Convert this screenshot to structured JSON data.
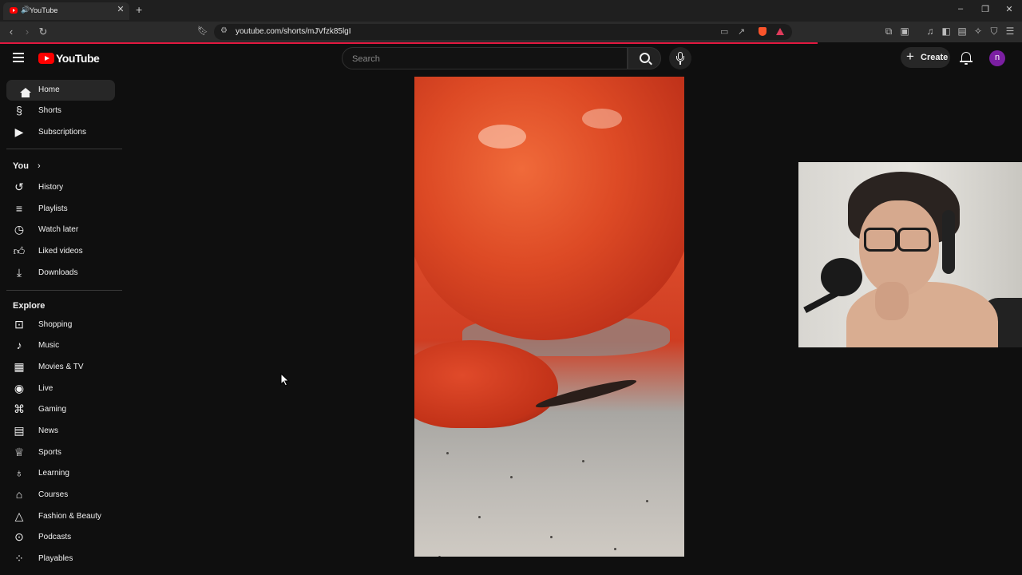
{
  "browser": {
    "tab": {
      "title": "YouTube"
    },
    "url": "youtube.com/shorts/mJVfzk85lgI"
  },
  "masthead": {
    "logo_text": "YouTube",
    "search_placeholder": "Search",
    "create_label": "Create",
    "avatar_letter": "n",
    "avatar_color": "#7b1fa2"
  },
  "sidebar": {
    "main": [
      {
        "label": "Home",
        "icon": "home-icon",
        "active": true
      },
      {
        "label": "Shorts",
        "icon": "shorts-icon"
      },
      {
        "label": "Subscriptions",
        "icon": "subscriptions-icon"
      }
    ],
    "you_heading": "You",
    "you": [
      {
        "label": "History",
        "icon": "history-icon"
      },
      {
        "label": "Playlists",
        "icon": "playlists-icon"
      },
      {
        "label": "Watch later",
        "icon": "watch-later-icon"
      },
      {
        "label": "Liked videos",
        "icon": "thumbs-up-icon"
      },
      {
        "label": "Downloads",
        "icon": "download-icon"
      }
    ],
    "explore_heading": "Explore",
    "explore": [
      {
        "label": "Shopping",
        "icon": "shopping-bag-icon"
      },
      {
        "label": "Music",
        "icon": "music-note-icon"
      },
      {
        "label": "Movies & TV",
        "icon": "clapperboard-icon"
      },
      {
        "label": "Live",
        "icon": "live-broadcast-icon"
      },
      {
        "label": "Gaming",
        "icon": "controller-icon"
      },
      {
        "label": "News",
        "icon": "newspaper-icon"
      },
      {
        "label": "Sports",
        "icon": "trophy-icon"
      },
      {
        "label": "Learning",
        "icon": "lightbulb-icon"
      },
      {
        "label": "Courses",
        "icon": "graduation-cap-icon"
      },
      {
        "label": "Fashion & Beauty",
        "icon": "hanger-icon"
      },
      {
        "label": "Podcasts",
        "icon": "podcast-icon"
      },
      {
        "label": "Playables",
        "icon": "playables-icon"
      }
    ]
  },
  "colors": {
    "background": "#0f0f0f",
    "brand_red": "#ff0000",
    "active_item": "#272727",
    "load_bar": "#e2183f"
  }
}
